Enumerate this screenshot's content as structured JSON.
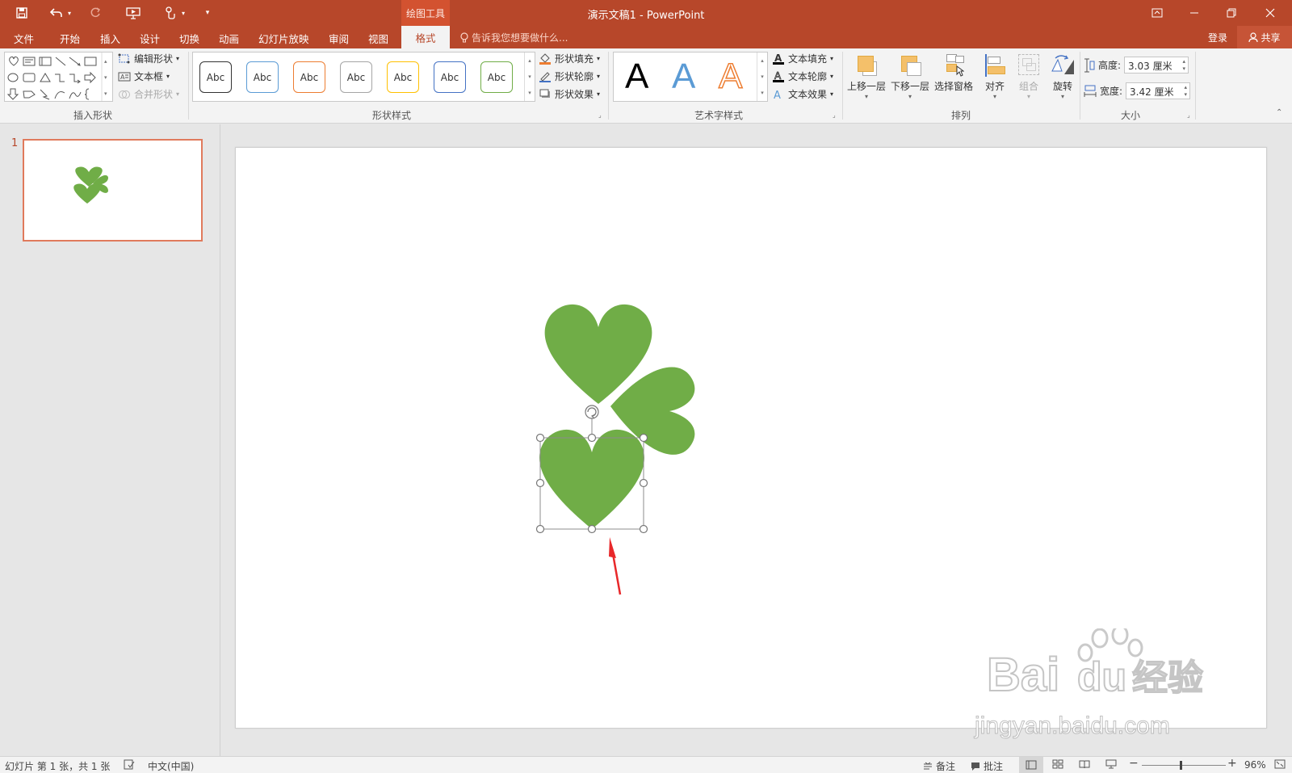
{
  "app": {
    "context_group": "绘图工具",
    "title": "演示文稿1 - PowerPoint"
  },
  "tabs": [
    "文件",
    "开始",
    "插入",
    "设计",
    "切换",
    "动画",
    "幻灯片放映",
    "审阅",
    "视图"
  ],
  "active_tab": "格式",
  "tell_me": "告诉我您想要做什么...",
  "account": {
    "signin": "登录",
    "share": "共享"
  },
  "ribbon": {
    "insert_shapes": {
      "label": "插入形状",
      "edit_shape": "编辑形状",
      "text_box": "文本框",
      "merge_shapes": "合并形状"
    },
    "shape_styles": {
      "label": "形状样式",
      "preview_text": "Abc",
      "swatches": [
        "#333333",
        "#5b9bd5",
        "#ed7d31",
        "#a5a5a5",
        "#ffc000",
        "#4472c4",
        "#70ad47"
      ],
      "fill": "形状填充",
      "outline": "形状轮廓",
      "effects": "形状效果"
    },
    "wordart": {
      "label": "艺术字样式",
      "glyph": "A",
      "text_fill": "文本填充",
      "text_outline": "文本轮廓",
      "text_effects": "文本效果"
    },
    "arrange": {
      "label": "排列",
      "bring_forward": "上移一层",
      "send_backward": "下移一层",
      "selection_pane": "选择窗格",
      "align": "对齐",
      "group": "组合",
      "rotate": "旋转"
    },
    "size": {
      "label": "大小",
      "height_label": "高度:",
      "height_value": "3.03 厘米",
      "width_label": "宽度:",
      "width_value": "3.42 厘米"
    }
  },
  "thumbnails": {
    "slide_number": "1"
  },
  "shape_color": "#70ad47",
  "annotation_color": "#e8282a",
  "status": {
    "slide_info": "幻灯片 第 1 张，共 1 张",
    "language": "中文(中国)",
    "notes": "备注",
    "comments": "批注",
    "zoom": "96%"
  },
  "watermark": {
    "logo": "Bai du 经验",
    "url": "jingyan.baidu.com"
  }
}
